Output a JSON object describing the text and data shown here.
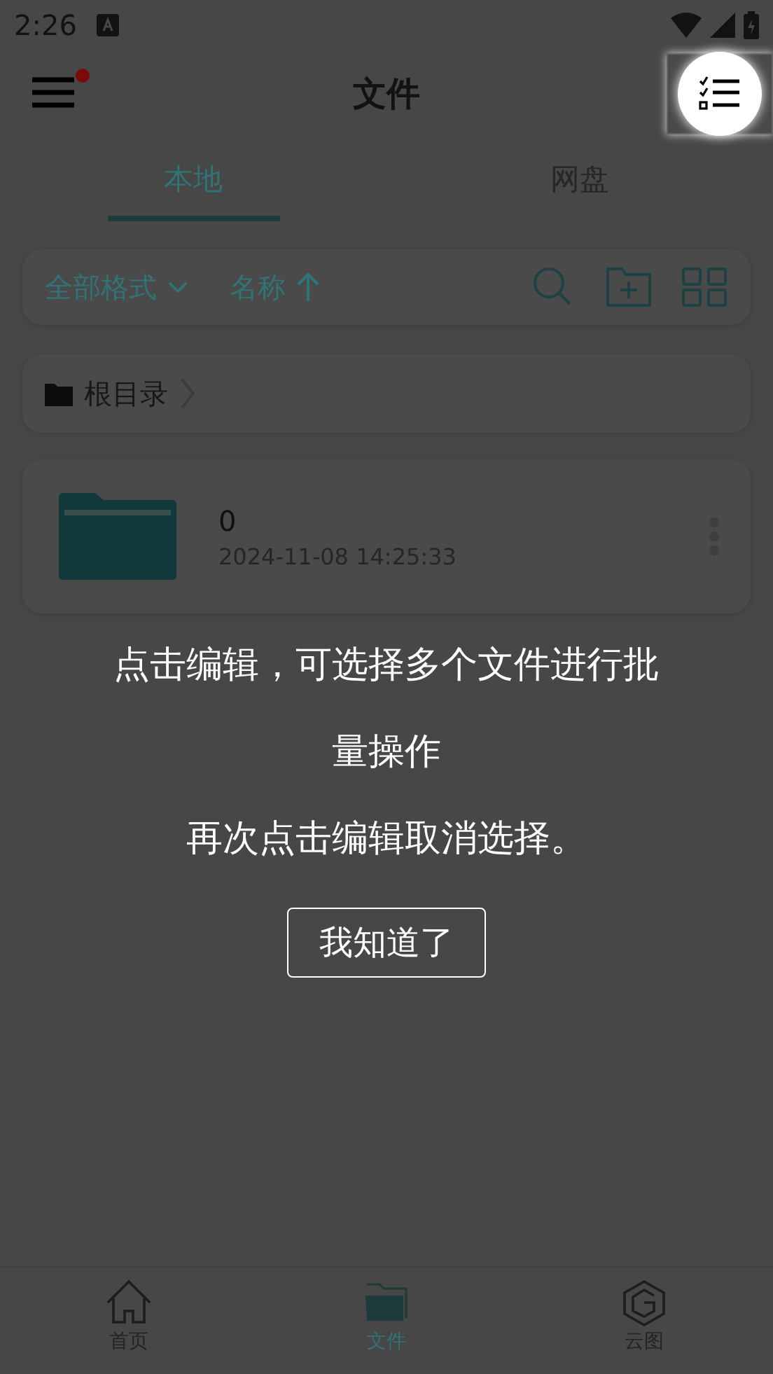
{
  "status_bar": {
    "time": "2:26"
  },
  "header": {
    "title": "文件",
    "menu_notification": true
  },
  "tabs": [
    {
      "label": "本地",
      "selected": true
    },
    {
      "label": "网盘",
      "selected": false
    }
  ],
  "toolbar": {
    "format_filter": "全部格式",
    "sort": "名称"
  },
  "breadcrumb": {
    "path": "根目录"
  },
  "files": [
    {
      "name": "0",
      "modified": "2024-11-08 14:25:33"
    }
  ],
  "guide": {
    "lines": [
      "点击编辑，可选择多个文件进行批量操作",
      "再次点击编辑取消选择。"
    ],
    "button": "我知道了"
  },
  "bottom_nav": [
    {
      "label": "首页",
      "selected": false
    },
    {
      "label": "文件",
      "selected": true
    },
    {
      "label": "云图",
      "selected": false
    }
  ]
}
